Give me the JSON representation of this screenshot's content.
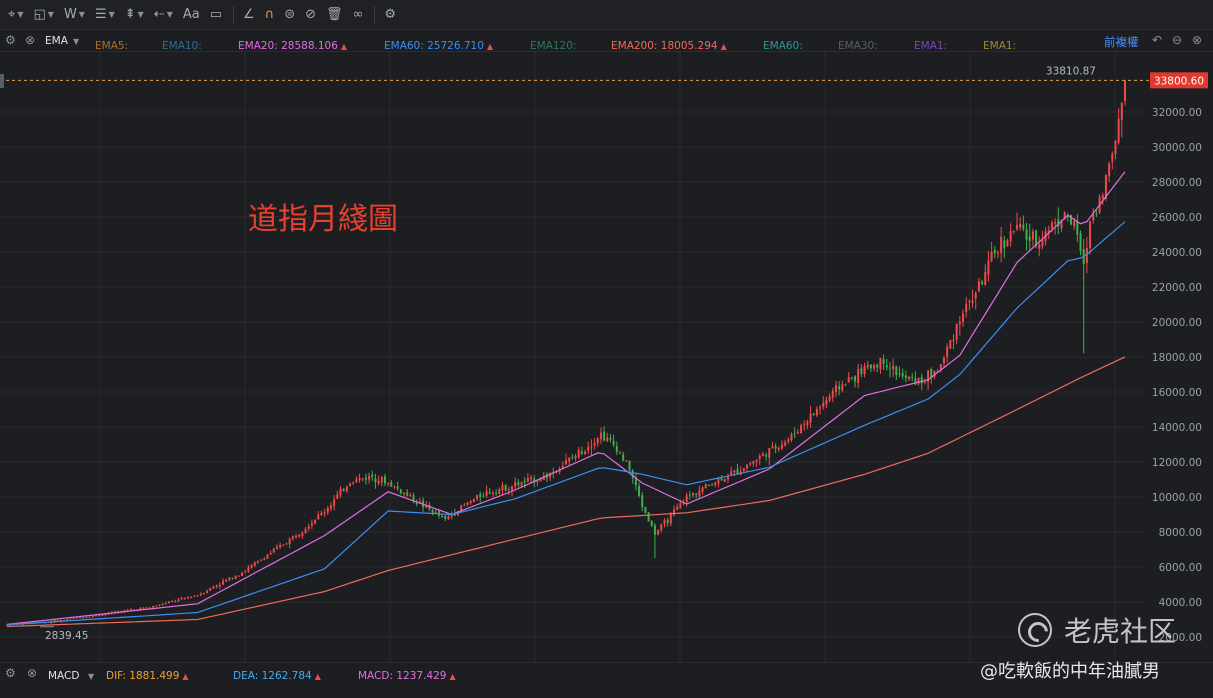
{
  "toolbar": {
    "items": [
      {
        "name": "cursor-tool",
        "glyph": "⌖",
        "chev": true
      },
      {
        "name": "shape-tool",
        "glyph": "◱",
        "chev": true
      },
      {
        "name": "pattern-tool",
        "glyph": "W",
        "chev": true
      },
      {
        "name": "fib-tool",
        "glyph": "☰",
        "chev": true
      },
      {
        "name": "measure-tool",
        "glyph": "⇞",
        "chev": true
      },
      {
        "name": "arrow-tool",
        "glyph": "⇠",
        "chev": true
      },
      {
        "name": "text-tool",
        "glyph": "Aa",
        "chev": false
      },
      {
        "name": "note-tool",
        "glyph": "▭",
        "chev": false
      },
      {
        "name": "ruler-tool",
        "glyph": "∠",
        "chev": false
      },
      {
        "name": "magnet-tool",
        "glyph": "∩",
        "chev": false
      },
      {
        "name": "lock-tool",
        "glyph": "⊜",
        "chev": false
      },
      {
        "name": "hide-tool",
        "glyph": "⊘",
        "chev": false
      },
      {
        "name": "delete-tool",
        "glyph": "🗑",
        "chev": false
      },
      {
        "name": "link-tool",
        "glyph": "∞",
        "chev": false
      },
      {
        "name": "settings-tool",
        "glyph": "⚙",
        "chev": false
      }
    ]
  },
  "legend": {
    "indicator": "EMA",
    "restore_label": "前複權",
    "emas": [
      {
        "label": "EMA5:",
        "value": "",
        "color": "#b0702a"
      },
      {
        "label": "EMA10:",
        "value": "",
        "color": "#2f6f8a"
      },
      {
        "label": "EMA20:",
        "value": "28588.106",
        "color": "#e070e0"
      },
      {
        "label": "EMA60:",
        "value": "25726.710",
        "color": "#3c8ff0"
      },
      {
        "label": "EMA120:",
        "value": "",
        "color": "#2c7a55"
      },
      {
        "label": "EMA200:",
        "value": "18005.294",
        "color": "#f06a5a"
      },
      {
        "label": "EMA60:",
        "value": "",
        "color": "#2a9a9a"
      },
      {
        "label": "EMA30:",
        "value": "",
        "color": "#5a5f66"
      },
      {
        "label": "EMA1:",
        "value": "",
        "color": "#7a4ab0"
      },
      {
        "label": "EMA1:",
        "value": "",
        "color": "#a08a30"
      }
    ]
  },
  "chart_label": "道指月綫圖",
  "macd": {
    "name": "MACD",
    "dif_label": "DIF: 1881.499",
    "dea_label": "DEA: 1262.784",
    "macd_label": "MACD: 1237.429"
  },
  "watermark": "老虎社区",
  "credit": "@吃軟飯的中年油膩男",
  "colors": {
    "up": "#ef4a4a",
    "down": "#3fb04a",
    "ema20": "#e070e0",
    "ema60": "#3c8ff0",
    "ema200": "#f06a5a",
    "grid": "#272a2f"
  },
  "chart_data": {
    "type": "candlestick",
    "title": "道指月綫圖",
    "ylim": [
      2000,
      34400
    ],
    "y_ticks": [
      "32000.00",
      "30000.00",
      "28000.00",
      "26000.00",
      "24000.00",
      "22000.00",
      "20000.00",
      "18000.00",
      "16000.00",
      "14000.00",
      "12000.00",
      "10000.00",
      "8000.00",
      "6000.00",
      "4000.00",
      "2000.00"
    ],
    "high_label": "33810.87",
    "low_label": "2839.45",
    "last_price": "33800.60",
    "close_path": [
      [
        0,
        2700
      ],
      [
        15,
        2900
      ],
      [
        30,
        3300
      ],
      [
        45,
        3700
      ],
      [
        60,
        4400
      ],
      [
        75,
        5800
      ],
      [
        90,
        7700
      ],
      [
        100,
        9200
      ],
      [
        108,
        10900
      ],
      [
        115,
        11200
      ],
      [
        120,
        10800
      ],
      [
        126,
        10100
      ],
      [
        132,
        9400
      ],
      [
        138,
        8700
      ],
      [
        142,
        9300
      ],
      [
        150,
        10200
      ],
      [
        160,
        10700
      ],
      [
        170,
        11200
      ],
      [
        180,
        12500
      ],
      [
        187,
        13600
      ],
      [
        192,
        12800
      ],
      [
        196,
        11600
      ],
      [
        200,
        9500
      ],
      [
        204,
        7900
      ],
      [
        208,
        8700
      ],
      [
        214,
        10000
      ],
      [
        222,
        10800
      ],
      [
        230,
        11500
      ],
      [
        238,
        12400
      ],
      [
        246,
        13300
      ],
      [
        254,
        14800
      ],
      [
        262,
        16300
      ],
      [
        270,
        17300
      ],
      [
        276,
        17800
      ],
      [
        282,
        16800
      ],
      [
        288,
        16600
      ],
      [
        294,
        17500
      ],
      [
        300,
        20300
      ],
      [
        306,
        22000
      ],
      [
        312,
        24300
      ],
      [
        318,
        25400
      ],
      [
        324,
        24500
      ],
      [
        330,
        25800
      ],
      [
        334,
        26100
      ],
      [
        337,
        25000
      ],
      [
        339,
        23000
      ],
      [
        341,
        25800
      ],
      [
        344,
        27000
      ],
      [
        348,
        29500
      ],
      [
        352,
        33800
      ]
    ],
    "ema_paths": {
      "ema20": [
        [
          0,
          2720
        ],
        [
          60,
          3900
        ],
        [
          100,
          7800
        ],
        [
          120,
          10300
        ],
        [
          140,
          9000
        ],
        [
          160,
          10400
        ],
        [
          187,
          12600
        ],
        [
          200,
          10800
        ],
        [
          214,
          9600
        ],
        [
          240,
          11600
        ],
        [
          270,
          15800
        ],
        [
          290,
          16700
        ],
        [
          300,
          18100
        ],
        [
          318,
          23400
        ],
        [
          334,
          26100
        ],
        [
          339,
          25500
        ],
        [
          352,
          28590
        ]
      ],
      "ema60": [
        [
          0,
          2700
        ],
        [
          60,
          3400
        ],
        [
          100,
          5900
        ],
        [
          120,
          9200
        ],
        [
          140,
          9000
        ],
        [
          160,
          9900
        ],
        [
          187,
          11700
        ],
        [
          200,
          11300
        ],
        [
          214,
          10700
        ],
        [
          240,
          11700
        ],
        [
          270,
          14100
        ],
        [
          290,
          15600
        ],
        [
          300,
          17000
        ],
        [
          318,
          20800
        ],
        [
          334,
          23500
        ],
        [
          339,
          23700
        ],
        [
          352,
          25727
        ]
      ],
      "ema200": [
        [
          0,
          2600
        ],
        [
          60,
          3000
        ],
        [
          100,
          4600
        ],
        [
          120,
          5800
        ],
        [
          140,
          6700
        ],
        [
          160,
          7600
        ],
        [
          187,
          8800
        ],
        [
          214,
          9100
        ],
        [
          240,
          9800
        ],
        [
          270,
          11300
        ],
        [
          290,
          12500
        ],
        [
          318,
          15000
        ],
        [
          339,
          16900
        ],
        [
          352,
          18005
        ]
      ]
    }
  }
}
